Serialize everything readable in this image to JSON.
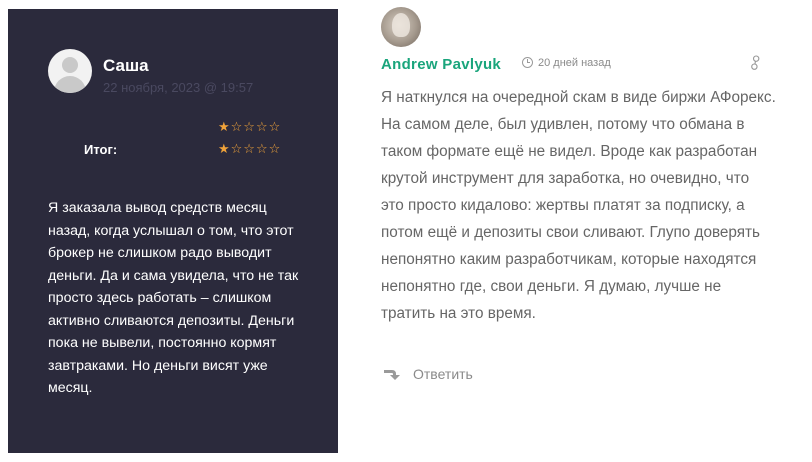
{
  "review": {
    "author": "Саша",
    "date": "22 ноября, 2023 @ 19:57",
    "rating_top": {
      "filled": 1,
      "max": 5
    },
    "total_label": "Итог:",
    "rating_total": {
      "filled": 1,
      "max": 5
    },
    "stars_top": "★☆☆☆☆",
    "stars_total": "★☆☆☆☆",
    "text": "Я заказала вывод средств месяц назад, когда услышал о том, что этот брокер не слишком радо выводит деньги. Да и сама увидела, что не так просто здесь работать – слишком активно сливаются депозиты. Деньги пока не вывели, постоянно кормят завтраками. Но деньги висят уже месяц."
  },
  "comment": {
    "author": "Andrew Pavlyuk",
    "time": "20 дней назад",
    "text": "Я наткнулся на очередной скам в виде биржи АФорекс. На самом деле, был удивлен, потому что обмана в таком формате ещё не видел. Вроде как разработан крутой инструмент для заработка, но очевидно, что это просто кидалово: жертвы платят за подписку, а потом ещё и депозиты свои сливают. Глупо доверять непонятно каким разработчикам, которые находятся непонятно где, свои деньги. Я думаю, лучше не тратить на это время.",
    "reply_label": "Ответить",
    "author_color": "#1aa57c"
  }
}
